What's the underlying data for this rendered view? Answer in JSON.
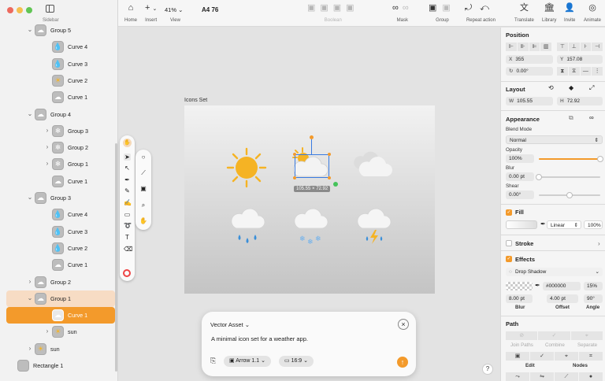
{
  "colors": {
    "accent": "#f39a2b",
    "selected_row": "#f39a2b",
    "highlight_row": "#f7dcc4",
    "sun": "#f5b324",
    "rain": "#3a8fd9"
  },
  "window": {
    "traffic_lights": [
      "#ed6a5e",
      "#f5bf4f",
      "#61c554"
    ]
  },
  "sidebar": {
    "title": "Sidebar",
    "layers": [
      {
        "label": "Group 5",
        "depth": 1,
        "expanded": true,
        "icon": "cloud-icon"
      },
      {
        "label": "Curve 4",
        "depth": 2,
        "icon": "drop-icon"
      },
      {
        "label": "Curve 3",
        "depth": 2,
        "icon": "drop-icon"
      },
      {
        "label": "Curve 2",
        "depth": 2,
        "icon": "sun-small-icon"
      },
      {
        "label": "Curve 1",
        "depth": 2,
        "icon": "cloud-icon"
      },
      {
        "label": "Group 4",
        "depth": 1,
        "expanded": true,
        "icon": "cloud-icon"
      },
      {
        "label": "Group 3",
        "depth": 2,
        "collapsed": true,
        "icon": "snowflake-icon"
      },
      {
        "label": "Group 2",
        "depth": 2,
        "collapsed": true,
        "icon": "snowflake-icon"
      },
      {
        "label": "Group 1",
        "depth": 2,
        "collapsed": true,
        "icon": "snowflake-icon"
      },
      {
        "label": "Curve 1",
        "depth": 2,
        "icon": "cloud-icon"
      },
      {
        "label": "Group 3",
        "depth": 1,
        "expanded": true,
        "icon": "cloud-icon"
      },
      {
        "label": "Curve 4",
        "depth": 2,
        "icon": "drop-icon"
      },
      {
        "label": "Curve 3",
        "depth": 2,
        "icon": "drop-icon"
      },
      {
        "label": "Curve 2",
        "depth": 2,
        "icon": "drop-icon"
      },
      {
        "label": "Curve 1",
        "depth": 2,
        "icon": "cloud-icon"
      },
      {
        "label": "Group 2",
        "depth": 1,
        "collapsed": true,
        "icon": "cloud-icon"
      },
      {
        "label": "Group 1",
        "depth": 1,
        "expanded": true,
        "icon": "cloud-icon",
        "state": "highlight"
      },
      {
        "label": "Curve 1",
        "depth": 2,
        "icon": "cloud-icon",
        "state": "selected"
      },
      {
        "label": "sun",
        "depth": 2,
        "collapsed": true,
        "icon": "sun-small-icon"
      },
      {
        "label": "sun",
        "depth": 1,
        "collapsed": true,
        "icon": "sun-small-icon"
      },
      {
        "label": "Rectangle 1",
        "depth": 0,
        "icon": "rectangle-icon"
      }
    ]
  },
  "toolbar": {
    "home": "Home",
    "insert": "Insert",
    "view": "View",
    "zoom": "41%",
    "doc_name": "A4 76",
    "boolean": "Boolean",
    "mask": "Mask",
    "group": "Group",
    "repeat_action": "Repeat action",
    "translate": "Translate",
    "library": "Library",
    "invite": "Invite",
    "animate": "Animate"
  },
  "canvas": {
    "artboard_label": "Icons Set",
    "dimension_badge": "105.55 × 72.92"
  },
  "prompt": {
    "title": "Vector Asset",
    "text": "A minimal icon set for a weather app.",
    "style_pill": "Arrow 1.1",
    "ratio_pill": "16:9"
  },
  "help_label": "?",
  "inspector": {
    "position": {
      "title": "Position",
      "x_label": "X",
      "x": "355",
      "y_label": "Y",
      "y": "157.08",
      "rotation": "0.00°"
    },
    "layout": {
      "title": "Layout",
      "w_label": "W",
      "w": "105.55",
      "h_label": "H",
      "h": "72.92"
    },
    "appearance": {
      "title": "Appearance",
      "blend_mode_label": "Blend Mode",
      "blend_mode": "Normal",
      "opacity_label": "Opacity",
      "opacity": "100%",
      "opacity_level": 1.0,
      "blur_label": "Blur",
      "blur": "0.00 pt",
      "blur_level": 0.0,
      "shear_label": "Shear",
      "shear": "0.00°",
      "shear_level": 0.5
    },
    "fill": {
      "title": "Fill",
      "type": "Linear",
      "opacity": "100%"
    },
    "stroke": {
      "title": "Stroke"
    },
    "effects": {
      "title": "Effects",
      "effect": "Drop Shadow",
      "color": "#000000",
      "opacity": "15%",
      "blur": "8.00 pt",
      "offset": "4.00 pt",
      "angle": "90°",
      "blur_label": "Blur",
      "offset_label": "Offset",
      "angle_label": "Angle"
    },
    "path": {
      "title": "Path",
      "join": "Join Paths",
      "combine": "Combine",
      "separate": "Separate",
      "edit": "Edit",
      "nodes": "Nodes"
    }
  }
}
